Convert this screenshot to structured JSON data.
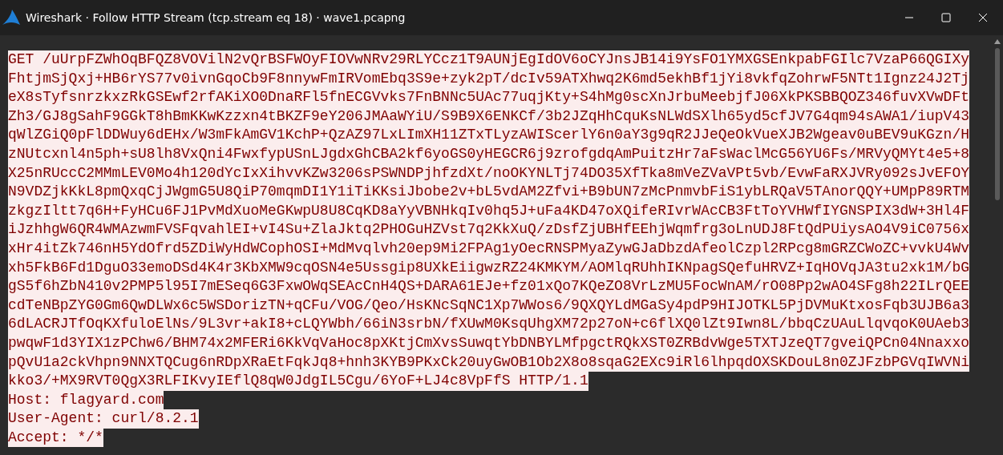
{
  "window": {
    "title": "Wireshark · Follow HTTP Stream (tcp.stream eq 18) · wave1.pcapng"
  },
  "stream": {
    "lines": [
      {
        "kind": "client",
        "text": "GET /uUrpFZWhOqBFQZ8VOVilN2vQrBSFWOyFIOVwNRv29RLYCcz1T9AUNjEgIdOV6oCYJnsJB14i9YsFO1YMXGSEnkpabFGIlc7VzaP66QGIXy"
      },
      {
        "kind": "client",
        "text": "FhtjmSjQxj+HB6rYS77v0ivnGqoCb9F8nnywFmIRVomEbq3S9e+zyk2pT/dcIv59ATXhwq2K6md5ekhBf1jYi8vkfqZohrwF5NTt1Ignz24J2Tj"
      },
      {
        "kind": "client",
        "text": "eX8sTyfsnrzkxzRkGSEwf2rfAKiXO0DnaRFl5fnECGVvks7FnBNNc5UAc77uqjKty+S4hMg0scXnJrbuMeebjfJ06XkPKSBBQOZ346fuvXVwDFt"
      },
      {
        "kind": "client",
        "text": "Zh3/GJ8gSahF9GGkT8hBmKKwKzzxn4tBKZF9eY206JMAaWYiU/S9B9X6ENKCf/3b2JZqHhCquKsNLWdSXlh65yd5cfJV7G4qm94sAWA1/iupV43"
      },
      {
        "kind": "client",
        "text": "qWlZGiQ0pFlDDWuy6dEHx/W3mFkAmGV1KchP+QzAZ97LxLImXH11ZTxTLyzAWIScerlY6n0aY3g9qR2JJeQeOkVueXJB2Wgeav0uBEV9uKGzn/H"
      },
      {
        "kind": "client",
        "text": "zNUtcxnl4n5ph+sU8lh8VxQni4FwxfypUSnLJgdxGhCBA2kf6yoGS0yHEGCR6j9zrofgdqAmPuitzHr7aFsWaclMcG56YU6Fs/MRVyQMYt4e5+8"
      },
      {
        "kind": "client",
        "text": "X25nRUccC2MMmLEV0Mo4h120dYcIxXihvvKZw3206sPSWNDPjhfzdXt/noOKYNLTj74DO35XfTka8mVeZVaVPt5vb/EvwFaRXJVRy092sJvEFOY"
      },
      {
        "kind": "client",
        "text": "N9VDZjkKkL8pmQxqCjJWgmG5U8QiP70mqmDI1Y1iTiKKsiJbobe2v+bL5vdAM2Zfvi+B9bUN7zMcPnmvbFiS1ybLRQaV5TAnorQQY+UMpP89RTM"
      },
      {
        "kind": "client",
        "text": "zkgzIltt7q6H+FyHCu6FJ1PvMdXuoMeGKwpU8U8CqKD8aYyVBNHkqIv0hq5J+uFa4KD47oXQifeRIvrWAcCB3FtToYVHWfIYGNSPIX3dW+3Hl4F"
      },
      {
        "kind": "client",
        "text": "iJzhhgW6QR4WMAzwmFVSFqvahlEI+vI4Su+ZlaJktq2PHOGuHZVst7q2KkXuQ/zDsfZjUBHfEEhjWqmfrg3oLnUDJ8FtQdPUiysAO4V9iC0756x"
      },
      {
        "kind": "client",
        "text": "xHr4itZk746nH5YdOfrd5ZDiWyHdWCophOSI+MdMvqlvh20ep9Mi2FPAg1yOecRNSPMyaZywGJaDbzdAfeolCzpl2RPcg8mGRZCWoZC+vvkU4Wv"
      },
      {
        "kind": "client",
        "text": "xh5FkB6Fd1DguO33emoDSd4K4r3KbXMW9cqOSN4e5Ussgip8UXkEiigwzRZ24KMKYM/AOMlqRUhhIKNpagSQefuHRVZ+IqHOVqJA3tu2xk1M/bG"
      },
      {
        "kind": "client",
        "text": "gS5f6hZbN410v2PMP5l95I7mESeq6G3FxwOWqSEAcCnH4QS+DARA61EJe+fz01xQo7KQeZO8VrLzMU5FocWnAM/rO08Pp2wAO4SFg8h22ILrQEE"
      },
      {
        "kind": "client",
        "text": "cdTeNBpZYG0Gm6QwDLWx6c5WSDorizTN+qCFu/VOG/Qeo/HsKNcSqNC1Xp7WWos6/9QXQYLdMGaSy4pdP9HIJOTKL5PjDVMuKtxosFqb3UJB6a3"
      },
      {
        "kind": "client",
        "text": "6dLACRJTfOqKXfuloElNs/9L3vr+akI8+cLQYWbh/66iN3srbN/fXUwM0KsqUhgXM72p27oN+c6flXQ0lZt9Iwn8L/bbqCzUAuLlqvqoK0UAeb3"
      },
      {
        "kind": "client",
        "text": "pwqwF1d3YIX1zPChw6/BHM74x2MFERi6KkVqVaHoc8pXKtjCmXvsSuwqtYbDNBYLMfpgctRQkXST0ZRBdvWge5TXTJzeQT7gveiQPCn04Nnaxxo"
      },
      {
        "kind": "client",
        "text": "pQvU1a2ckVhpn9NNXTQCug6nRDpXRaEtFqkJq8+hnh3KYB9PKxCk20uyGwOB1Ob2X8o8sqaG2EXc9iRl6lhpqdOXSKDouL8n0ZJFzbPGVqIWVNi"
      },
      {
        "kind": "client",
        "text": "kko3/+MX9RVT0QgX3RLFIKvyIEflQ8qW0JdgIL5Cgu/6YoF+LJ4c8VpFfS HTTP/1.1"
      },
      {
        "kind": "client",
        "text": "Host: flagyard.com"
      },
      {
        "kind": "client",
        "text": "User-Agent: curl/8.2.1"
      },
      {
        "kind": "client",
        "text": "Accept: */*"
      }
    ]
  }
}
